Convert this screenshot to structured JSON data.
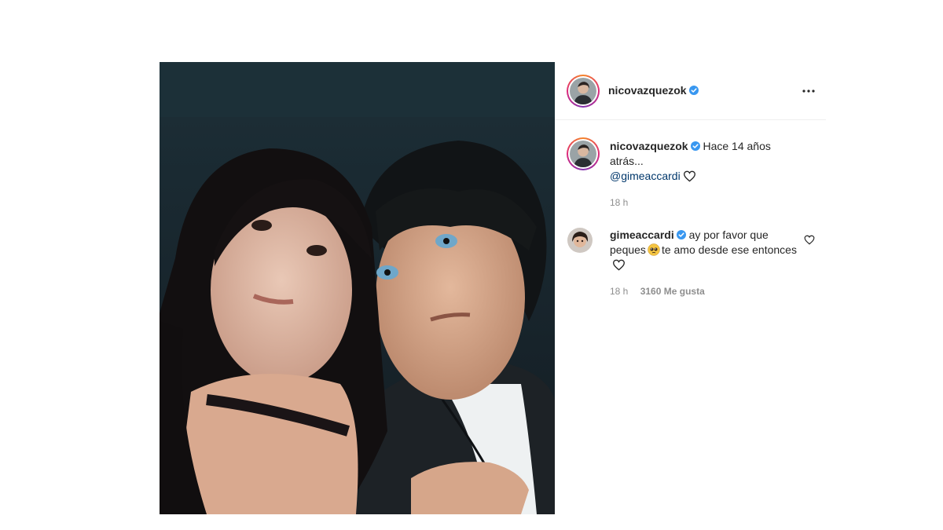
{
  "post": {
    "author": "nicovazquezok",
    "caption": {
      "username": "nicovazquezok",
      "text": "Hace 14 años atrás...",
      "mention": "@gimeaccardi",
      "time": "18 h"
    },
    "comment": {
      "username": "gimeaccardi",
      "text_before_emoji": "ay por favor que peques",
      "text_after_emoji": "te amo desde ese entonces",
      "emoji": "pleading-face-emoji",
      "time": "18 h",
      "likes": "3160 Me gusta"
    }
  },
  "icons": {
    "verified": "verified-badge-icon",
    "more": "more-options-icon",
    "heart": "heart-icon"
  },
  "colors": {
    "verified": "#3897f0",
    "text": "#262626",
    "meta": "#8e8e8e",
    "mention": "#00376b"
  }
}
